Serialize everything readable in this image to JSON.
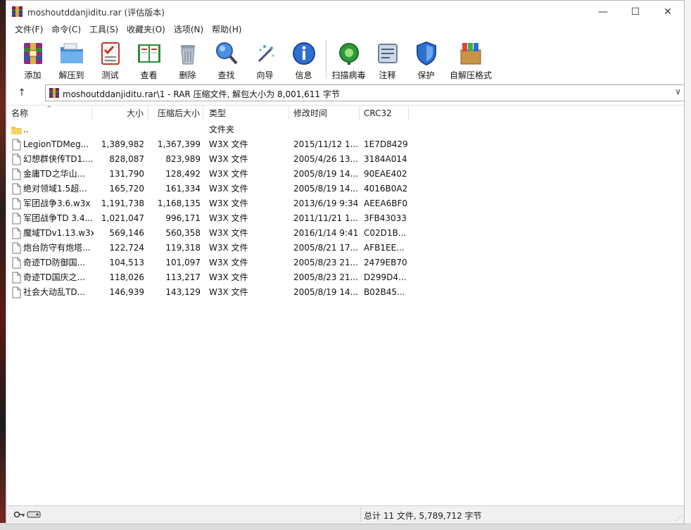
{
  "window": {
    "title": "moshoutddanjiditu.rar (评估版本)",
    "min_glyph": "—",
    "max_glyph": "☐",
    "close_glyph": "✕"
  },
  "menu": [
    {
      "label": "文件(F)"
    },
    {
      "label": "命令(C)"
    },
    {
      "label": "工具(S)"
    },
    {
      "label": "收藏夹(O)"
    },
    {
      "label": "选项(N)"
    },
    {
      "label": "帮助(H)"
    }
  ],
  "toolbar": [
    {
      "label": "添加",
      "icon": "add-archive-icon"
    },
    {
      "label": "解压到",
      "icon": "extract-folder-icon"
    },
    {
      "label": "测试",
      "icon": "test-checklist-icon"
    },
    {
      "label": "查看",
      "icon": "view-book-icon"
    },
    {
      "label": "删除",
      "icon": "trash-icon"
    },
    {
      "label": "查找",
      "icon": "magnifier-icon"
    },
    {
      "label": "向导",
      "icon": "wizard-wand-icon"
    },
    {
      "label": "信息",
      "icon": "info-icon"
    },
    {
      "label": "扫描病毒",
      "icon": "virus-scan-icon"
    },
    {
      "label": "注释",
      "icon": "comment-icon"
    },
    {
      "label": "保护",
      "icon": "shield-icon"
    },
    {
      "label": "自解压格式",
      "icon": "sfx-box-icon"
    }
  ],
  "address": {
    "up_glyph": "↑",
    "path": "moshoutddanjiditu.rar\\1 - RAR 压缩文件, 解包大小为 8,001,611 字节",
    "dropdown_glyph": "∨"
  },
  "columns": {
    "name": "名称",
    "size": "大小",
    "packed": "压缩后大小",
    "type": "类型",
    "modified": "修改时间",
    "crc": "CRC32",
    "sort_glyph": "^"
  },
  "files": [
    {
      "name": "..",
      "size": "",
      "packed": "",
      "type": "文件夹",
      "modified": "",
      "crc": "",
      "kind": "folder"
    },
    {
      "name": "LegionTDMeg...",
      "size": "1,389,982",
      "packed": "1,367,399",
      "type": "W3X 文件",
      "modified": "2015/11/12 1...",
      "crc": "1E7D8429",
      "kind": "file"
    },
    {
      "name": "幻想群侠传TD1....",
      "size": "828,087",
      "packed": "823,989",
      "type": "W3X 文件",
      "modified": "2005/4/26 13...",
      "crc": "3184A014",
      "kind": "file"
    },
    {
      "name": "金庸TD之华山...",
      "size": "131,790",
      "packed": "128,492",
      "type": "W3X 文件",
      "modified": "2005/8/19 14...",
      "crc": "90EAE402",
      "kind": "file"
    },
    {
      "name": "绝对领域1.5超...",
      "size": "165,720",
      "packed": "161,334",
      "type": "W3X 文件",
      "modified": "2005/8/19 14...",
      "crc": "4016B0A2",
      "kind": "file"
    },
    {
      "name": "军团战争3.6.w3x",
      "size": "1,191,738",
      "packed": "1,168,135",
      "type": "W3X 文件",
      "modified": "2013/6/19 9:34",
      "crc": "AEEA6BF0",
      "kind": "file"
    },
    {
      "name": "军团战争TD 3.4....",
      "size": "1,021,047",
      "packed": "996,171",
      "type": "W3X 文件",
      "modified": "2011/11/21 1...",
      "crc": "3FB43033",
      "kind": "file"
    },
    {
      "name": "魔域TDv1.13.w3x",
      "size": "569,146",
      "packed": "560,358",
      "type": "W3X 文件",
      "modified": "2016/1/14 9:41",
      "crc": "C02D1B...",
      "kind": "file"
    },
    {
      "name": "炮台防守有炮塔...",
      "size": "122,724",
      "packed": "119,318",
      "type": "W3X 文件",
      "modified": "2005/8/21 17...",
      "crc": "AFB1EE...",
      "kind": "file"
    },
    {
      "name": "奇迹TD防御国...",
      "size": "104,513",
      "packed": "101,097",
      "type": "W3X 文件",
      "modified": "2005/8/23 21...",
      "crc": "2479EB70",
      "kind": "file"
    },
    {
      "name": "奇迹TD国庆之...",
      "size": "118,026",
      "packed": "113,217",
      "type": "W3X 文件",
      "modified": "2005/8/23 21...",
      "crc": "D299D4...",
      "kind": "file"
    },
    {
      "name": "社会大动乱TD...",
      "size": "146,939",
      "packed": "143,129",
      "type": "W3X 文件",
      "modified": "2005/8/19 14...",
      "crc": "B02B45...",
      "kind": "file"
    }
  ],
  "status": {
    "summary": "总计 11 文件, 5,789,712 字节",
    "icons": [
      "key-icon",
      "drive-icon"
    ]
  },
  "colors": {
    "accent_blue": "#2b6fd6",
    "folder_yellow": "#f3c343",
    "rar_red": "#c0392b"
  }
}
